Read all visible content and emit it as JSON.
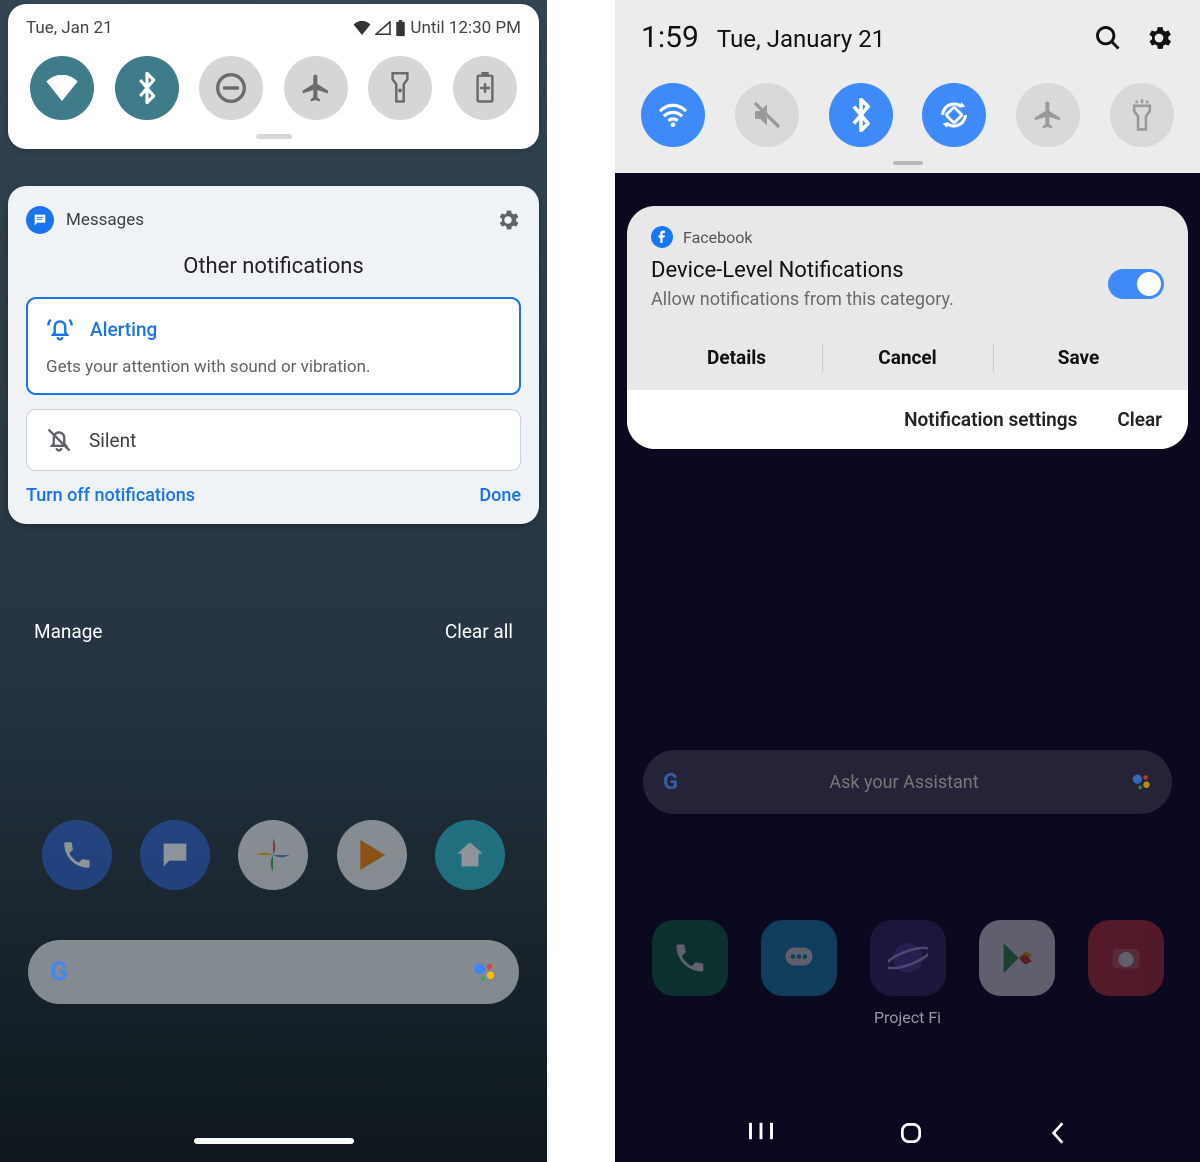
{
  "pixel": {
    "status": {
      "date": "Tue, Jan 21",
      "battery_until": "Until 12:30 PM"
    },
    "toggles": [
      {
        "name": "wifi",
        "on": true
      },
      {
        "name": "bluetooth",
        "on": true
      },
      {
        "name": "dnd",
        "on": false
      },
      {
        "name": "airplane",
        "on": false
      },
      {
        "name": "flashlight",
        "on": false
      },
      {
        "name": "battery-saver",
        "on": false
      }
    ],
    "card": {
      "app_name": "Messages",
      "title": "Other notifications",
      "options": {
        "alerting": {
          "label": "Alerting",
          "desc": "Gets your attention with sound or vibration."
        },
        "silent": {
          "label": "Silent"
        }
      },
      "turn_off": "Turn off notifications",
      "done": "Done"
    },
    "shade_footer": {
      "manage": "Manage",
      "clear_all": "Clear all"
    }
  },
  "samsung": {
    "status": {
      "time": "1:59",
      "date": "Tue, January 21"
    },
    "toggles": [
      {
        "name": "wifi",
        "on": true
      },
      {
        "name": "sound-mute",
        "on": false
      },
      {
        "name": "bluetooth",
        "on": true
      },
      {
        "name": "auto-rotate",
        "on": true
      },
      {
        "name": "airplane",
        "on": false
      },
      {
        "name": "flashlight",
        "on": false
      }
    ],
    "card": {
      "app_name": "Facebook",
      "title": "Device-Level Notifications",
      "subtitle": "Allow notifications from this category.",
      "toggle_on": true,
      "actions": {
        "details": "Details",
        "cancel": "Cancel",
        "save": "Save"
      },
      "footer": {
        "settings": "Notification settings",
        "clear": "Clear"
      }
    },
    "home": {
      "assistant_placeholder": "Ask your Assistant",
      "folder_label": "Project Fi"
    }
  }
}
